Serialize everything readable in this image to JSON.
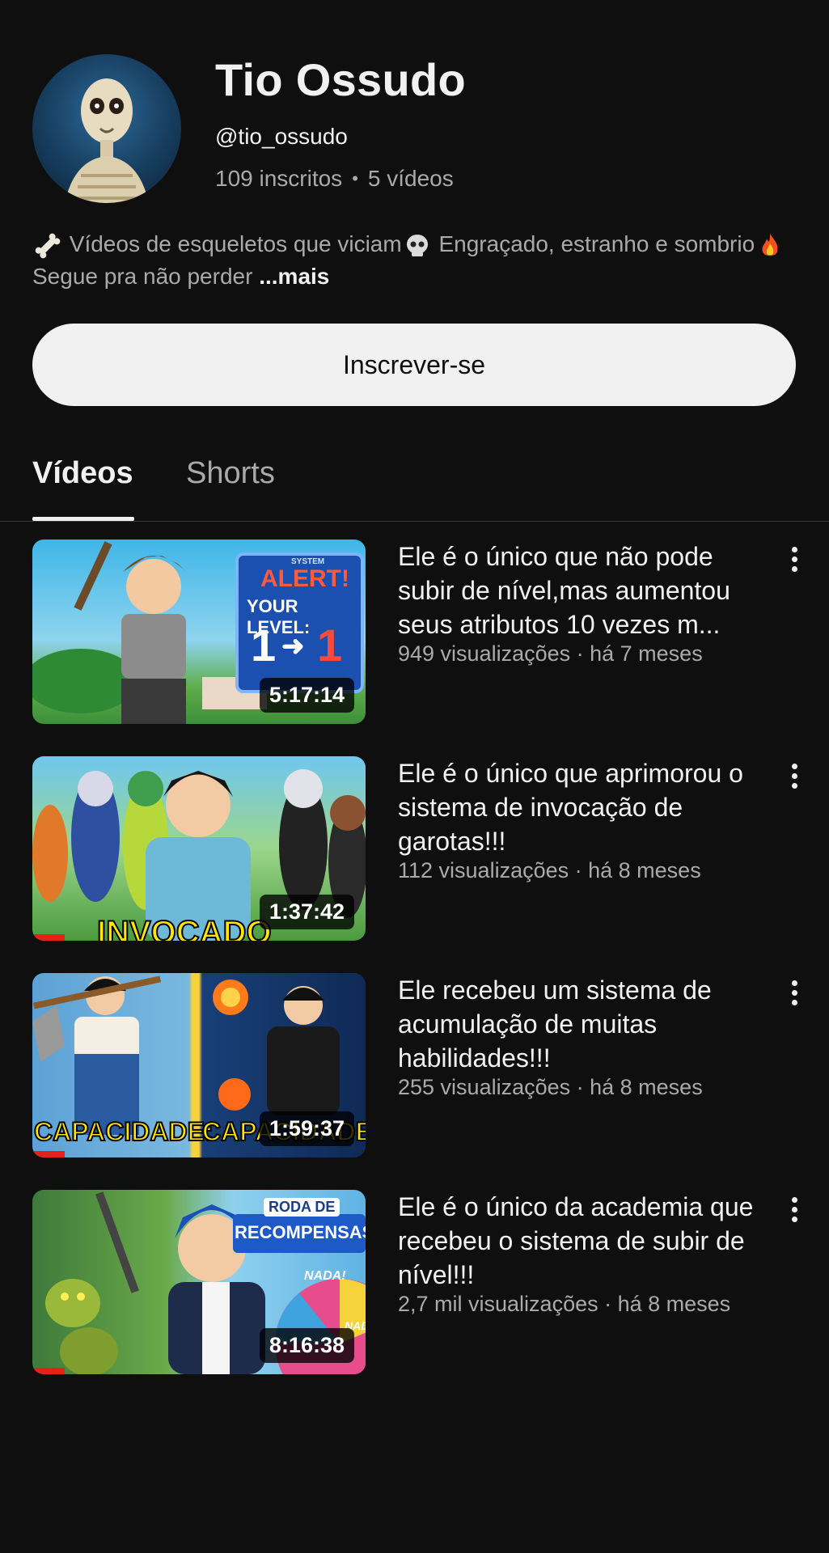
{
  "channel": {
    "name": "Tio Ossudo",
    "handle": "@tio_ossudo",
    "subscribers": "109 inscritos",
    "separator": "•",
    "video_count": "5 vídeos",
    "description_part1": "Vídeos de esqueletos que viciam",
    "description_part2": "Engraçado, estranho e",
    "description_part3": "sombrio",
    "description_part4": "Segue pra não perder",
    "more_label": "...mais",
    "icons": [
      "bone-icon",
      "skull-icon",
      "fire-icon"
    ]
  },
  "subscribe_label": "Inscrever-se",
  "tabs": [
    {
      "label": "Vídeos",
      "active": true
    },
    {
      "label": "Shorts",
      "active": false
    }
  ],
  "videos": [
    {
      "title": "Ele é o único que não pode subir de nível,mas aumentou seus atributos 10 vezes m...",
      "meta": "949 visualizações · há 7 meses",
      "duration": "5:17:14",
      "thumb_text": [
        "SYSTEM",
        "ALERT!",
        "YOUR LEVEL:",
        "1",
        "1"
      ],
      "progress": 0
    },
    {
      "title": "Ele é o único que aprimorou o sistema de invocação de garotas!!!",
      "meta": "112 visualizações · há 8 meses",
      "duration": "1:37:42",
      "thumb_text": [
        "INVOCADO"
      ],
      "progress": 0.1
    },
    {
      "title": "Ele recebeu um sistema de acumulação de muitas habilidades!!!",
      "meta": "255 visualizações · há 8 meses",
      "duration": "1:59:37",
      "thumb_text": [
        "CAPACIDADE:",
        "CAPACIDADE:"
      ],
      "progress": 0.1
    },
    {
      "title": "Ele é o único da academia que recebeu o sistema de subir de nível!!!",
      "meta": "2,7 mil visualizações · há 8 meses",
      "duration": "8:16:38",
      "thumb_text": [
        "RODA DE",
        "RECOMPENSAS:",
        "NADA!",
        "NADA"
      ],
      "progress": 0.1
    }
  ],
  "colors": {
    "background": "#0f0f0f",
    "text_primary": "#f1f1f1",
    "text_secondary": "#aaaaaa",
    "progress_red": "#e62117"
  }
}
